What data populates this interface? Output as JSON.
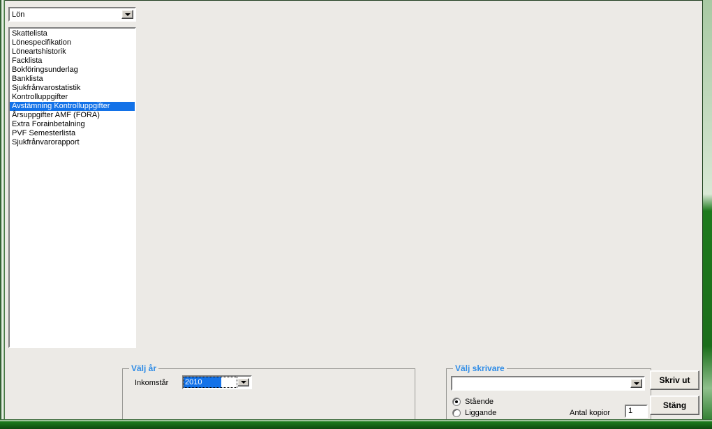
{
  "window": {
    "chrome_color": "#1c7a1c",
    "client_background": "#eceae6"
  },
  "source_combo": {
    "name": "module-selector",
    "value": "Lön",
    "arrow_icon": "chevron-down-icon"
  },
  "report_list": {
    "selected_index": 8,
    "selection_color": "#1372e8",
    "items": [
      "Skattelista",
      "Lönespecifikation",
      "Löneartshistorik",
      "Facklista",
      "Bokföringsunderlag",
      "Banklista",
      "Sjukfrånvarostatistik",
      "Kontrolluppgifter",
      "Avstämning Kontrolluppgifter",
      "Årsuppgifter AMF (FORA)",
      "Extra Forainbetalning",
      "PVF Semesterlista",
      "Sjukfrånvarorapport"
    ]
  },
  "year_group": {
    "legend": "Välj år",
    "legend_color": "#2f8ce6",
    "income_year_label": "Inkomstår",
    "year_value": "2010",
    "arrow_icon": "chevron-down-icon"
  },
  "printer_group": {
    "legend": "Välj skrivare",
    "legend_color": "#2f8ce6",
    "printer_value": "",
    "arrow_icon": "chevron-down-icon",
    "orientation": {
      "portrait_label": "Stående",
      "landscape_label": "Liggande",
      "selected": "Stående"
    },
    "copies_label": "Antal kopior",
    "copies_value": "1"
  },
  "buttons": {
    "print_label": "Skriv ut",
    "close_label": "Stäng"
  }
}
